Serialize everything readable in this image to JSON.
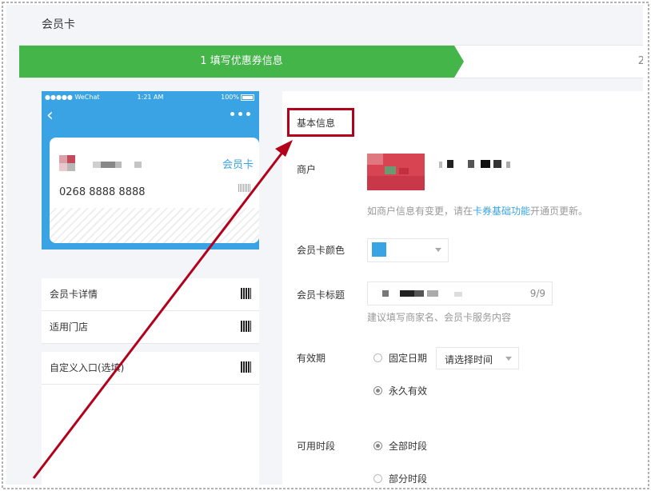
{
  "page": {
    "title": "会员卡"
  },
  "progress": {
    "step1_label": "1 填写优惠券信息",
    "step2_number": "2"
  },
  "phone": {
    "status": {
      "carrier": "●●●●● WeChat",
      "time": "1:21 AM",
      "battery": "100%"
    },
    "card": {
      "type_label": "会员卡",
      "number": "0268 8888 8888"
    },
    "menu": [
      {
        "label": "会员卡详情"
      },
      {
        "label": "适用门店"
      },
      {
        "label": "自定义入口(选填)"
      }
    ]
  },
  "form": {
    "section_title": "基本信息",
    "merchant": {
      "label": "商户",
      "hint_before": "如商户信息有变更，请在",
      "hint_link": "卡券基础功能",
      "hint_after": "开通页更新。"
    },
    "card_color": {
      "label": "会员卡颜色",
      "value_color": "#3aa3e3"
    },
    "card_title": {
      "label": "会员卡标题",
      "counter": "9/9",
      "hint": "建议填写商家名、会员卡服务内容"
    },
    "validity": {
      "label": "有效期",
      "options": [
        {
          "label": "固定日期",
          "checked": false
        },
        {
          "label": "永久有效",
          "checked": true
        }
      ],
      "date_placeholder": "请选择时间"
    },
    "available_time": {
      "label": "可用时段",
      "options": [
        {
          "label": "全部时段",
          "checked": true
        },
        {
          "label": "部分时段",
          "checked": false
        }
      ]
    }
  },
  "colors": {
    "accent": "#44b549",
    "brand_blue": "#3aa3e3",
    "annotation": "#b3001b"
  }
}
